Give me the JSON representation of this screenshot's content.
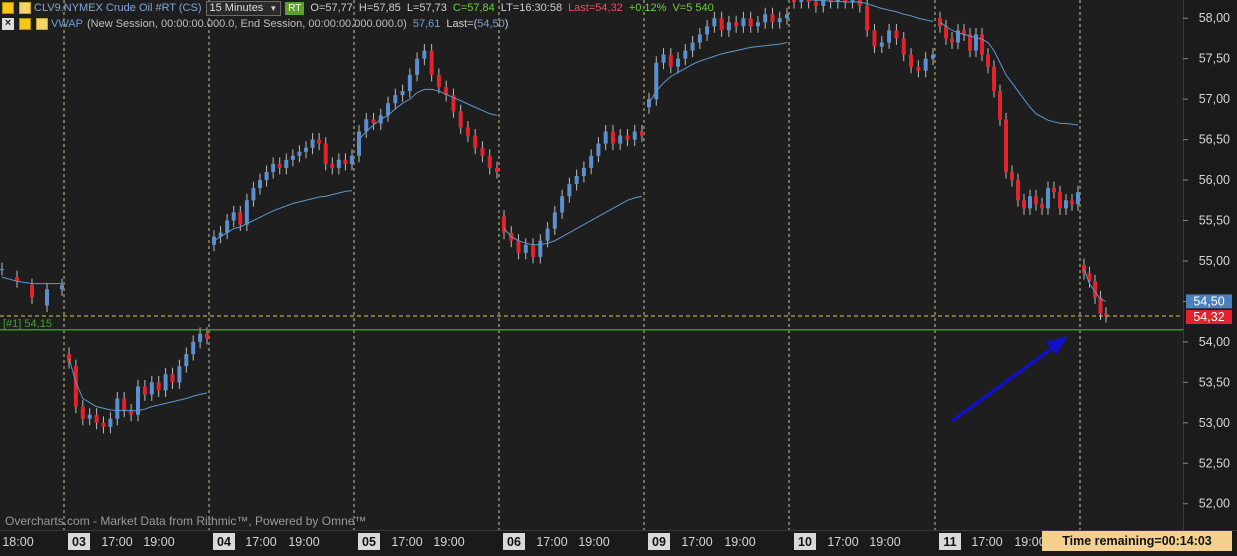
{
  "header": {
    "symbol": "CLV9.NYMEX Crude Oil #RT (CS)",
    "timeframe": "15 Minutes",
    "rt": "RT",
    "open": "O=57,77",
    "high": "H=57,85",
    "low": "L=57,73",
    "close": "C=57,84",
    "last_time": "LT=16:30:58",
    "last": "Last=54,32",
    "change": "+0.12%",
    "volume": "V=5 540"
  },
  "vwap_header": {
    "name": "VWAP",
    "params": "(New Session, 00:00:00.000.0, End Session, 00:00:00.000.000.0)",
    "value": "57,61",
    "last_prefix": "Last=(",
    "last_value": "54,50",
    "last_suffix": ")"
  },
  "footer": {
    "note": "Overcharts.com - Market Data from Rithmic™, Powered by Omne™",
    "time_remaining": "Time remaining=00:14:03"
  },
  "colors": {
    "background": "#1e1e1e",
    "bull": "#5b8fcf",
    "bear": "#e4222c",
    "vwap": "#5f97cf",
    "grid": "#e8e49a",
    "hline": "#2f9b22",
    "arrow": "#1010c8",
    "last_badge": "#e4222c",
    "vwap_badge": "#4a7fc0"
  },
  "chart_data": {
    "type": "candlestick",
    "title": "CLV9.NYMEX Crude Oil #RT (CS)",
    "timeframe": "15 Minutes",
    "ylim": [
      51.7,
      58.25
    ],
    "y_ticks": [
      "58,00",
      "57,50",
      "57,00",
      "56,50",
      "56,00",
      "55,50",
      "55,00",
      "54,50",
      "54,00",
      "53,50",
      "53,00",
      "52,50",
      "52,00"
    ],
    "x_labels": [
      {
        "text": "18:00",
        "strong": false
      },
      {
        "text": "03",
        "strong": true
      },
      {
        "text": "17:00",
        "strong": false
      },
      {
        "text": "19:00",
        "strong": false
      },
      {
        "text": "04",
        "strong": true
      },
      {
        "text": "17:00",
        "strong": false
      },
      {
        "text": "19:00",
        "strong": false
      },
      {
        "text": "05",
        "strong": true
      },
      {
        "text": "17:00",
        "strong": false
      },
      {
        "text": "19:00",
        "strong": false
      },
      {
        "text": "06",
        "strong": true
      },
      {
        "text": "17:00",
        "strong": false
      },
      {
        "text": "19:00",
        "strong": false
      },
      {
        "text": "09",
        "strong": true
      },
      {
        "text": "17:00",
        "strong": false
      },
      {
        "text": "19:00",
        "strong": false
      },
      {
        "text": "10",
        "strong": true
      },
      {
        "text": "17:00",
        "strong": false
      },
      {
        "text": "19:00",
        "strong": false
      },
      {
        "text": "11",
        "strong": true
      },
      {
        "text": "17:00",
        "strong": false
      },
      {
        "text": "19:00",
        "strong": false
      }
    ],
    "horizontal_line": {
      "label": "[#1] 54,15",
      "value": 54.15
    },
    "last_price": {
      "label": "54,32",
      "value": 54.32
    },
    "vwap_last": {
      "label": "54,50",
      "value": 54.5
    },
    "sessions": [
      {
        "pts": [
          [
            54.9,
            54.9
          ],
          [
            54.8,
            54.75
          ],
          [
            54.7,
            54.55
          ],
          [
            54.45,
            54.65
          ],
          [
            54.65,
            54.7
          ]
        ],
        "vwap": [
          54.8,
          54.75,
          54.72,
          54.72,
          54.72
        ]
      },
      {
        "pts": [
          [
            53.85,
            53.75
          ],
          [
            53.7,
            53.2
          ],
          [
            53.2,
            53.05
          ],
          [
            53.05,
            53.1
          ],
          [
            53.1,
            53.0
          ],
          [
            53.0,
            52.95
          ],
          [
            52.95,
            53.05
          ],
          [
            53.05,
            53.3
          ],
          [
            53.3,
            53.15
          ],
          [
            53.15,
            53.1
          ],
          [
            53.1,
            53.45
          ],
          [
            53.45,
            53.35
          ],
          [
            53.35,
            53.5
          ],
          [
            53.5,
            53.4
          ],
          [
            53.4,
            53.6
          ],
          [
            53.6,
            53.5
          ],
          [
            53.5,
            53.7
          ],
          [
            53.7,
            53.85
          ],
          [
            53.85,
            54.0
          ],
          [
            54.0,
            54.1
          ],
          [
            54.1,
            54.05
          ]
        ],
        "vwap": [
          53.8,
          53.5,
          53.3,
          53.25,
          53.2,
          53.18,
          53.16,
          53.15,
          53.15,
          53.15,
          53.15,
          53.17,
          53.2,
          53.22,
          53.24,
          53.26,
          53.28,
          53.3,
          53.33,
          53.35,
          53.37
        ]
      },
      {
        "pts": [
          [
            55.2,
            55.3
          ],
          [
            55.3,
            55.35
          ],
          [
            55.35,
            55.5
          ],
          [
            55.5,
            55.6
          ],
          [
            55.6,
            55.45
          ],
          [
            55.45,
            55.75
          ],
          [
            55.75,
            55.9
          ],
          [
            55.9,
            56.0
          ],
          [
            56.0,
            56.1
          ],
          [
            56.1,
            56.2
          ],
          [
            56.2,
            56.15
          ],
          [
            56.15,
            56.25
          ],
          [
            56.25,
            56.3
          ],
          [
            56.3,
            56.35
          ],
          [
            56.35,
            56.4
          ],
          [
            56.4,
            56.5
          ],
          [
            56.5,
            56.45
          ],
          [
            56.45,
            56.2
          ],
          [
            56.2,
            56.15
          ],
          [
            56.15,
            56.25
          ],
          [
            56.25,
            56.2
          ],
          [
            56.2,
            56.3
          ]
        ],
        "vwap": [
          55.25,
          55.3,
          55.35,
          55.4,
          55.42,
          55.46,
          55.5,
          55.54,
          55.58,
          55.62,
          55.65,
          55.68,
          55.71,
          55.73,
          55.75,
          55.77,
          55.79,
          55.8,
          55.82,
          55.84,
          55.86,
          55.87
        ]
      },
      {
        "pts": [
          [
            56.3,
            56.6
          ],
          [
            56.6,
            56.75
          ],
          [
            56.75,
            56.7
          ],
          [
            56.7,
            56.8
          ],
          [
            56.8,
            56.95
          ],
          [
            56.95,
            57.05
          ],
          [
            57.05,
            57.1
          ],
          [
            57.1,
            57.3
          ],
          [
            57.3,
            57.5
          ],
          [
            57.5,
            57.6
          ],
          [
            57.6,
            57.3
          ],
          [
            57.3,
            57.15
          ],
          [
            57.15,
            57.05
          ],
          [
            57.05,
            56.85
          ],
          [
            56.85,
            56.65
          ],
          [
            56.65,
            56.55
          ],
          [
            56.55,
            56.4
          ],
          [
            56.4,
            56.3
          ],
          [
            56.3,
            56.15
          ],
          [
            56.15,
            56.1
          ]
        ],
        "vwap": [
          56.5,
          56.6,
          56.68,
          56.75,
          56.8,
          56.88,
          56.95,
          57.0,
          57.08,
          57.12,
          57.12,
          57.1,
          57.06,
          57.02,
          56.98,
          56.94,
          56.9,
          56.86,
          56.82,
          56.8
        ]
      },
      {
        "pts": [
          [
            55.55,
            55.35
          ],
          [
            55.35,
            55.25
          ],
          [
            55.25,
            55.1
          ],
          [
            55.1,
            55.2
          ],
          [
            55.2,
            55.05
          ],
          [
            55.05,
            55.25
          ],
          [
            55.25,
            55.4
          ],
          [
            55.4,
            55.6
          ],
          [
            55.6,
            55.8
          ],
          [
            55.8,
            55.95
          ],
          [
            55.95,
            56.05
          ],
          [
            56.05,
            56.15
          ],
          [
            56.15,
            56.3
          ],
          [
            56.3,
            56.45
          ],
          [
            56.45,
            56.6
          ],
          [
            56.6,
            56.45
          ],
          [
            56.45,
            56.55
          ],
          [
            56.55,
            56.5
          ],
          [
            56.5,
            56.6
          ],
          [
            56.6,
            56.55
          ]
        ],
        "vwap": [
          55.4,
          55.3,
          55.25,
          55.22,
          55.2,
          55.2,
          55.22,
          55.25,
          55.3,
          55.35,
          55.4,
          55.45,
          55.5,
          55.55,
          55.6,
          55.65,
          55.7,
          55.75,
          55.78,
          55.8
        ]
      },
      {
        "pts": [
          [
            56.9,
            57.0
          ],
          [
            57.0,
            57.45
          ],
          [
            57.45,
            57.55
          ],
          [
            57.55,
            57.4
          ],
          [
            57.4,
            57.5
          ],
          [
            57.5,
            57.6
          ],
          [
            57.6,
            57.7
          ],
          [
            57.7,
            57.8
          ],
          [
            57.8,
            57.9
          ],
          [
            57.9,
            58.0
          ],
          [
            58.0,
            57.85
          ],
          [
            57.85,
            57.95
          ],
          [
            57.95,
            57.9
          ],
          [
            57.9,
            58.0
          ],
          [
            58.0,
            57.9
          ],
          [
            57.9,
            57.95
          ],
          [
            57.95,
            58.05
          ],
          [
            58.05,
            57.95
          ],
          [
            57.95,
            58.0
          ],
          [
            58.0,
            58.05
          ]
        ],
        "vwap": [
          56.95,
          57.1,
          57.2,
          57.28,
          57.33,
          57.38,
          57.43,
          57.47,
          57.5,
          57.53,
          57.56,
          57.58,
          57.6,
          57.62,
          57.64,
          57.65,
          57.66,
          57.67,
          57.68,
          57.7
        ]
      },
      {
        "pts": [
          [
            58.25,
            58.2
          ],
          [
            58.2,
            58.25
          ],
          [
            58.25,
            58.2
          ],
          [
            58.2,
            58.15
          ],
          [
            58.15,
            58.25
          ],
          [
            58.25,
            58.2
          ],
          [
            58.2,
            58.25
          ],
          [
            58.25,
            58.2
          ],
          [
            58.2,
            58.25
          ],
          [
            58.25,
            58.15
          ],
          [
            58.15,
            57.85
          ],
          [
            57.85,
            57.65
          ],
          [
            57.65,
            57.7
          ],
          [
            57.7,
            57.85
          ],
          [
            57.85,
            57.75
          ],
          [
            57.75,
            57.55
          ],
          [
            57.55,
            57.4
          ],
          [
            57.4,
            57.35
          ],
          [
            57.35,
            57.5
          ],
          [
            57.5,
            57.55
          ]
        ],
        "vwap": [
          58.25,
          58.24,
          58.23,
          58.22,
          58.22,
          58.21,
          58.21,
          58.2,
          58.2,
          58.2,
          58.18,
          58.15,
          58.12,
          58.1,
          58.08,
          58.05,
          58.03,
          58.0,
          57.98,
          57.96
        ]
      },
      {
        "pts": [
          [
            58.0,
            57.9
          ],
          [
            57.9,
            57.75
          ],
          [
            57.75,
            57.7
          ],
          [
            57.7,
            57.85
          ],
          [
            57.85,
            57.8
          ],
          [
            57.8,
            57.6
          ],
          [
            57.6,
            57.8
          ],
          [
            57.8,
            57.55
          ],
          [
            57.55,
            57.4
          ],
          [
            57.4,
            57.1
          ],
          [
            57.1,
            56.75
          ],
          [
            56.75,
            56.1
          ],
          [
            56.1,
            56.0
          ],
          [
            56.0,
            55.75
          ],
          [
            55.75,
            55.65
          ],
          [
            55.65,
            55.8
          ],
          [
            55.8,
            55.7
          ],
          [
            55.7,
            55.65
          ],
          [
            55.65,
            55.9
          ],
          [
            55.9,
            55.85
          ],
          [
            55.85,
            55.65
          ],
          [
            55.65,
            55.75
          ],
          [
            55.75,
            55.7
          ],
          [
            55.7,
            55.85
          ]
        ],
        "vwap": [
          57.95,
          57.9,
          57.85,
          57.82,
          57.8,
          57.78,
          57.76,
          57.74,
          57.7,
          57.6,
          57.45,
          57.3,
          57.2,
          57.1,
          57.0,
          56.9,
          56.82,
          56.78,
          56.74,
          56.72,
          56.7,
          56.7,
          56.69,
          56.68
        ]
      },
      {
        "pts": [
          [
            54.95,
            54.85
          ],
          [
            54.85,
            54.75
          ],
          [
            54.75,
            54.55
          ],
          [
            54.55,
            54.35
          ],
          [
            54.35,
            54.32
          ]
        ],
        "vwap": [
          54.9,
          54.72,
          54.62,
          54.53,
          54.5
        ]
      }
    ]
  }
}
